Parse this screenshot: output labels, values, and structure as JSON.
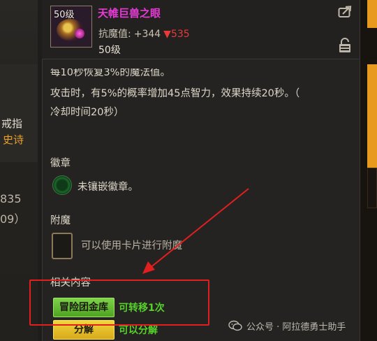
{
  "background": {
    "ring_label": "戒指",
    "rarity_label": "史诗",
    "number_1": "835",
    "number_2": "09）"
  },
  "item": {
    "level_badge": "50级",
    "name": "天帷巨兽之眼",
    "stat_label": "抗魔值:",
    "stat_plus": "+344",
    "stat_down": "▼535",
    "required_level": "50级",
    "name_color": "#e83ad7",
    "down_color": "#e83a3a"
  },
  "description": {
    "line_0": "每10秒恢复3%的魔法值。",
    "line_1": "攻击时，有5%的概率增加45点智力，效果持续20秒。（",
    "line_2": "冷却时间20秒）"
  },
  "emblem": {
    "title": "徽章",
    "slot_text": "未镶嵌徽章。"
  },
  "enchant": {
    "title": "附魔",
    "slot_text": "可以使用卡片进行附魔"
  },
  "related": {
    "title": "相关内容",
    "bank_button": "冒险团金库",
    "bank_note": "可转移1次",
    "split_button": "分解",
    "split_note": "可以分解"
  },
  "icons": {
    "share": "share-icon",
    "lock": "lock-icon",
    "wechat": "wechat-icon"
  },
  "watermark": {
    "text": "公众号 · 阿拉德勇士助手"
  }
}
